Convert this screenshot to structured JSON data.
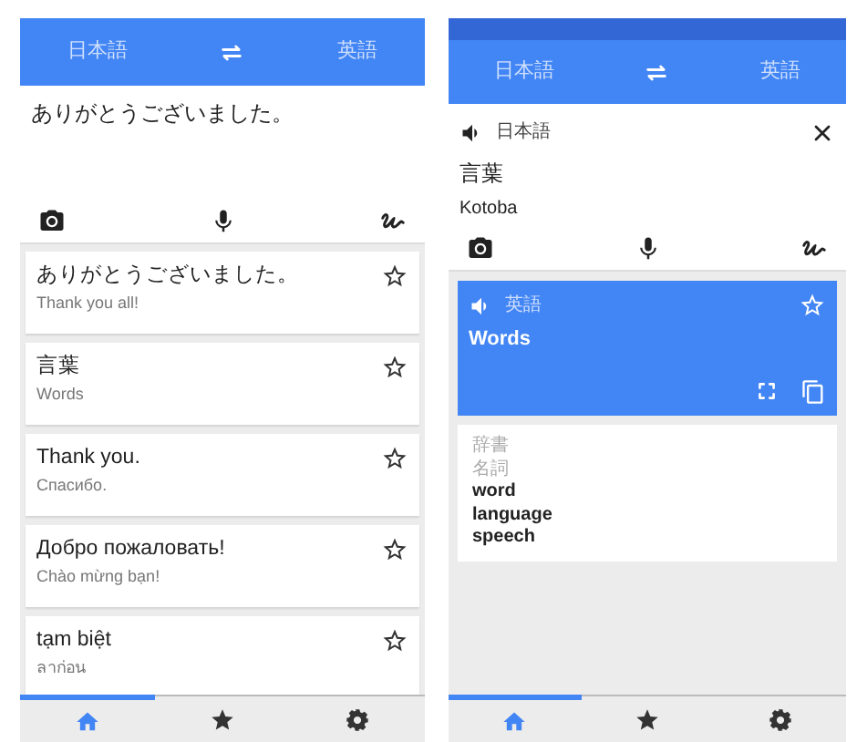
{
  "left_screen": {
    "header": {
      "source_language": "日本語",
      "target_language": "英語"
    },
    "input": {
      "value": "ありがとうございました。"
    },
    "history": [
      {
        "text": "ありがとうございました。",
        "translation": "Thank you all!",
        "starred": false
      },
      {
        "text": "言葉",
        "translation": "Words",
        "starred": false
      },
      {
        "text": "Thank you.",
        "translation": "Спасибо.",
        "starred": false
      },
      {
        "text": "Добро пожаловать!",
        "translation": "Chào mừng bạn!",
        "starred": false
      },
      {
        "text": "tạm biệt",
        "translation": "ลาก่อน",
        "starred": false
      }
    ],
    "nav": [
      {
        "kind": "home",
        "selected": true
      },
      {
        "kind": "favorites",
        "selected": false
      },
      {
        "kind": "settings",
        "selected": false
      }
    ]
  },
  "right_screen": {
    "header": {
      "source_language": "日本語",
      "target_language": "英語"
    },
    "input": {
      "language_label": "日本語",
      "value": "言葉",
      "transliteration": "Kotoba"
    },
    "result": {
      "language_label": "英語",
      "text": "Words",
      "starred": false
    },
    "dictionary": {
      "label": "辞書",
      "part_of_speech": "名詞",
      "entries": [
        "word",
        "language",
        "speech"
      ]
    },
    "nav": [
      {
        "kind": "home",
        "selected": true
      },
      {
        "kind": "favorites",
        "selected": false
      },
      {
        "kind": "settings",
        "selected": false
      }
    ]
  }
}
